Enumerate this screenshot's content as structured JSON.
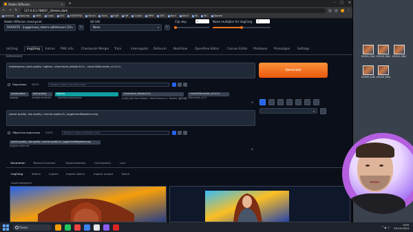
{
  "browser": {
    "tab_title": "Stable Diffusion",
    "url": "127.0.0.1:7860/?__theme=dark",
    "bookmarks": [
      "Android",
      "Браузер",
      "WEB",
      "Граф",
      "SEO",
      "КЛИЕНТЫ",
      "Почта",
      "Банк",
      "КДИ",
      "ИИ",
      "Crypto",
      "MPM",
      "GPU",
      "Bard",
      "Dall-E",
      "MJ",
      "IRC",
      "Прочее"
    ]
  },
  "header": {
    "checkpoint_label": "Stable Diffusion checkpoint",
    "checkpoint_value": "FAVORITE - ljuggernaut_reborn.safetensors [10",
    "vae_label": "SD VAE",
    "vae_value": "None",
    "clip_skip_label": "Clip skip",
    "clip_skip_value": "1",
    "noise_label": "Noise multiplier for img2img",
    "noise_value": "1"
  },
  "tabs": [
    "txt2img",
    "img2img",
    "Extras",
    "PNG Info",
    "Checkpoint Merger",
    "Train",
    "Interrogator",
    "Deforum",
    "NextView",
    "OpenPose Editor",
    "Canvas Editor",
    "Photopea",
    "Promptgen",
    "Settings"
  ],
  "extensions_tab": "Extensions",
  "prompt": {
    "text": "masterpiece, best quality, highres, <lora:more_details:0.5>, <lora:SDXLrender_v2.0:1>",
    "hint_label": "Подсказка",
    "hint_count": "26/75",
    "hint_placeholder": "Введите новую ключевое слово",
    "tags": [
      "masterpiece",
      "best quality",
      "highres",
      "<lora:more_details:0.5>",
      "<lora:SDXLrender_v2.0:1>"
    ],
    "tag_subs": [
      "шедевр",
      "лучшее качество",
      "высокое разрешение",
      "[LoRA] Add More Details - Detail Enhancer / Tweaker (细节调整) LoRA",
      "SDXLrender_v2.0"
    ]
  },
  "negative": {
    "text": "(worst quality, low quality, normal quality:2), JuggernautNegative-neg",
    "hint_label": "Обратная подсказка",
    "hint_count": "23/75",
    "hint_placeholder": "Введите новую ключевое слово",
    "tag": "(worst quality, low quality, normal quality:2), JuggernautNegative-neg",
    "tag_sub": "Худшее качество"
  },
  "generate_label": "Generate",
  "subtabs": [
    "Generation",
    "Textual Inversion",
    "Hypernetworks",
    "Checkpoints",
    "Lora"
  ],
  "img_tabs": [
    "img2img",
    "Sketch",
    "Inpaint",
    "Inpaint sketch",
    "Inpaint upload",
    "Batch"
  ],
  "inpaint_bg_label": "Inpaint background",
  "desktop_files": [
    "00001-3443...",
    "00020-3626...",
    "00021-3626...",
    "00000-1082...",
    "00030-3626..."
  ],
  "taskbar": {
    "search_placeholder": "Поиск",
    "time": "0:00",
    "date": "03.04.2024"
  },
  "colors": {
    "accent": "#f97316",
    "panel": "#1f2937",
    "bg": "#0b0f19"
  }
}
